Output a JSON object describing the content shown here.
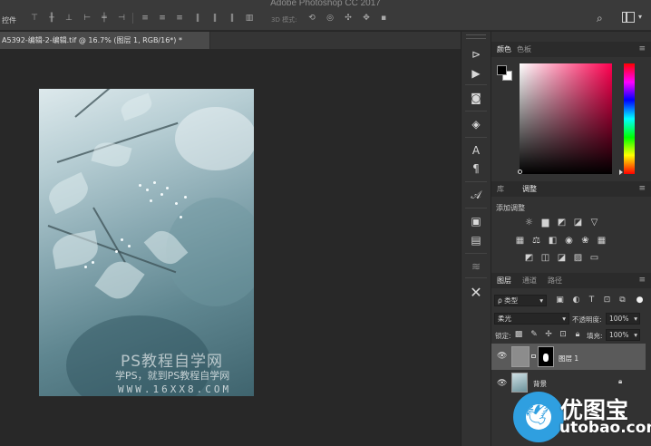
{
  "app": {
    "title": "Adobe Photoshop CC 2017"
  },
  "options_bar": {
    "label": "控件",
    "mode_3d_label": "3D 模式:",
    "align_icons": [
      "align-top-icon",
      "align-vcenter-icon",
      "align-bottom-icon",
      "align-left-icon",
      "align-hcenter-icon",
      "align-right-icon",
      "distribute-top-icon",
      "distribute-vcenter-icon",
      "distribute-bottom-icon",
      "distribute-left-icon",
      "distribute-hcenter-icon",
      "distribute-right-icon",
      "auto-align-icon"
    ],
    "mode_3d_icons": [
      "orbit-3d-icon",
      "roll-3d-icon",
      "pan-3d-icon",
      "slide-3d-icon",
      "scale-3d-icon"
    ],
    "right_icons": [
      "search-icon",
      "workspace-icon"
    ]
  },
  "document": {
    "tab_title": "A5392-编辑-2-编辑.tif @ 16.7% (图层 1, RGB/16*) *",
    "watermark": {
      "line1": "PS教程自学网",
      "line2": "学PS，就到PS教程自学网",
      "line3": "WWW.16XX8.COM"
    }
  },
  "tools": [
    "history-brush-icon",
    "play-icon",
    "histogram-icon",
    "3d-object-icon",
    "character-icon",
    "paragraph-icon",
    "glyphs-icon",
    "libraries-icon",
    "notes-icon",
    "brush-settings-icon",
    "tool-presets-icon"
  ],
  "color_panel": {
    "tabs": [
      "颜色",
      "色板"
    ],
    "active_tab": 0,
    "foreground": "#000000",
    "background": "#ffffff",
    "hue_color": "#ff0050"
  },
  "adjustments_panel": {
    "tabs": [
      "库",
      "调整"
    ],
    "active_tab": 1,
    "title": "添加调整",
    "rows": [
      [
        "brightness-contrast-icon",
        "levels-icon",
        "curves-icon",
        "exposure-icon",
        "vibrance-icon"
      ],
      [
        "hue-saturation-icon",
        "color-balance-icon",
        "black-white-icon",
        "photo-filter-icon",
        "channel-mixer-icon",
        "color-lookup-icon"
      ],
      [
        "invert-icon",
        "posterize-icon",
        "threshold-icon",
        "selective-color-icon",
        "gradient-map-icon"
      ]
    ]
  },
  "layers_panel": {
    "tabs": [
      "图层",
      "通道",
      "路径"
    ],
    "active_tab": 0,
    "filter_kind": "ρ 类型",
    "filter_icons": [
      "pixel-filter-icon",
      "adjustment-filter-icon",
      "type-filter-icon",
      "shape-filter-icon",
      "smart-object-filter-icon",
      "toggle-filter-icon"
    ],
    "blend_mode": "柔光",
    "opacity_label": "不透明度:",
    "opacity_value": "100%",
    "lock_label": "锁定:",
    "lock_icons": [
      "lock-transparent-icon",
      "lock-image-icon",
      "lock-position-icon",
      "lock-artboard-icon",
      "lock-all-icon"
    ],
    "fill_label": "填充:",
    "fill_value": "100%",
    "layers": [
      {
        "name": "图层 1",
        "selected": true,
        "has_mask": true,
        "visible": true
      },
      {
        "name": "背景",
        "selected": false,
        "locked": true,
        "visible": true
      }
    ]
  },
  "logo": {
    "name": "优图宝",
    "url": "utobao.com"
  }
}
